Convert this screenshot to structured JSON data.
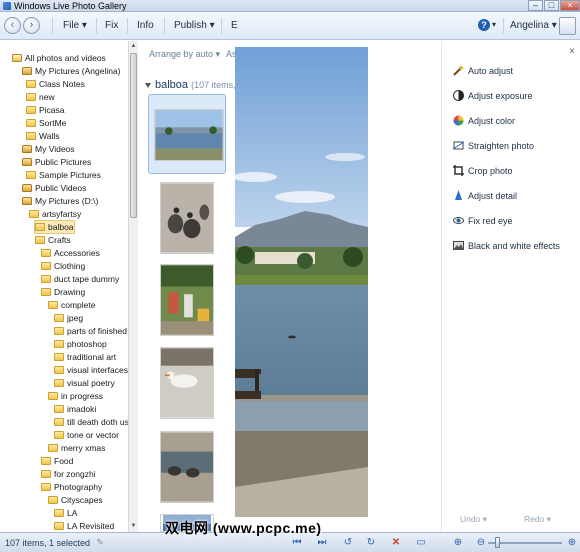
{
  "window": {
    "title": "Windows Live Photo Gallery",
    "minimize": "–",
    "maximize": "□",
    "close": "×"
  },
  "menu": {
    "back": "‹",
    "forward": "›",
    "items": [
      "File ▾",
      "Fix",
      "Info",
      "Publish ▾",
      "E"
    ],
    "help": "?",
    "help_caret": "▾",
    "user": "Angelina ▾"
  },
  "tree": {
    "items": [
      {
        "label": "All photos and videos"
      },
      {
        "label": "My Pictures (Angelina)"
      },
      {
        "label": "Class Notes"
      },
      {
        "label": "new"
      },
      {
        "label": "Picasa"
      },
      {
        "label": "SortMe"
      },
      {
        "label": "Walls"
      },
      {
        "label": "My Videos"
      },
      {
        "label": "Public Pictures"
      },
      {
        "label": "Sample Pictures"
      },
      {
        "label": "Public Videos"
      },
      {
        "label": "My Pictures (D:\\)"
      },
      {
        "label": "artsyfartsy"
      },
      {
        "label": "balboa"
      },
      {
        "label": "Crafts"
      },
      {
        "label": "Accessories"
      },
      {
        "label": "Clothing"
      },
      {
        "label": "duct tape dummy"
      },
      {
        "label": "Drawing"
      },
      {
        "label": "complete"
      },
      {
        "label": "jpeg"
      },
      {
        "label": "parts of finished"
      },
      {
        "label": "photoshop"
      },
      {
        "label": "traditional art"
      },
      {
        "label": "visual interfaces"
      },
      {
        "label": "visual poetry"
      },
      {
        "label": "in progress"
      },
      {
        "label": "imadoki"
      },
      {
        "label": "till death doth us"
      },
      {
        "label": "tone or vector"
      },
      {
        "label": "merry xmas"
      },
      {
        "label": "Food"
      },
      {
        "label": "for zongzhi"
      },
      {
        "label": "Photography"
      },
      {
        "label": "Cityscapes"
      },
      {
        "label": "LA"
      },
      {
        "label": "LA Revisited"
      }
    ]
  },
  "content": {
    "arrange": "Arrange by auto ▾",
    "arrange_more": "As",
    "group_name": "balboa",
    "group_count": "(107 items,"
  },
  "fix_panel": {
    "items": [
      {
        "label": "Auto adjust",
        "icon": "magic-wand-icon"
      },
      {
        "label": "Adjust exposure",
        "icon": "exposure-icon"
      },
      {
        "label": "Adjust color",
        "icon": "color-wheel-icon"
      },
      {
        "label": "Straighten photo",
        "icon": "straighten-icon"
      },
      {
        "label": "Crop photo",
        "icon": "crop-icon"
      },
      {
        "label": "Adjust detail",
        "icon": "detail-icon"
      },
      {
        "label": "Fix red eye",
        "icon": "eye-icon"
      },
      {
        "label": "Black and white effects",
        "icon": "bw-effects-icon"
      }
    ],
    "undo": "Undo ▾",
    "redo": "Redo ▾",
    "collapse": "×"
  },
  "status": {
    "text": "107 items, 1 selected",
    "watermark": "双电网 (www.pcpc.me)"
  },
  "colors": {
    "accent": "#1e5fb3",
    "selection": "#fbe9b8"
  }
}
